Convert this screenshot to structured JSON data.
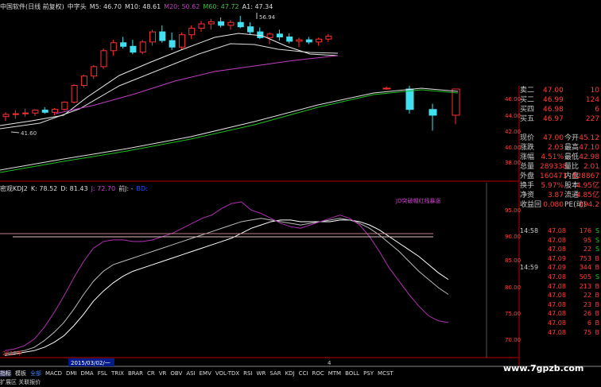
{
  "header": {
    "title": "中国软件(日线 前复权)",
    "pattern": "中字头",
    "ma5": "M5: 46.70",
    "ma10": "M10: 48.61",
    "ma20": "M20: 50.62",
    "ma60": "M60: 47.72",
    "a1": "A1: 47.34"
  },
  "kline": {
    "high_label": "56.94",
    "low_label": "41.60",
    "candles": [
      [
        43.0,
        43.6,
        42.4,
        43.3
      ],
      [
        43.3,
        43.9,
        42.7,
        43.4
      ],
      [
        43.4,
        44.1,
        43.0,
        43.5
      ],
      [
        43.5,
        44.0,
        43.1,
        43.9
      ],
      [
        43.9,
        44.3,
        43.4,
        43.6
      ],
      [
        43.6,
        44.2,
        43.2,
        44.0
      ],
      [
        44.0,
        45.1,
        43.8,
        45.0
      ],
      [
        45.0,
        47.5,
        44.8,
        47.3
      ],
      [
        47.3,
        48.8,
        47.0,
        48.6
      ],
      [
        48.6,
        50.1,
        48.2,
        49.9
      ],
      [
        49.9,
        52.4,
        49.6,
        52.1
      ],
      [
        52.1,
        53.6,
        51.4,
        53.2
      ],
      [
        53.2,
        54.0,
        52.4,
        52.7
      ],
      [
        52.7,
        53.6,
        51.6,
        51.9
      ],
      [
        51.9,
        53.6,
        51.6,
        53.3
      ],
      [
        53.3,
        55.0,
        52.8,
        54.7
      ],
      [
        54.7,
        55.6,
        53.2,
        53.5
      ],
      [
        53.5,
        54.6,
        52.2,
        52.6
      ],
      [
        52.6,
        54.6,
        52.2,
        54.3
      ],
      [
        54.3,
        55.6,
        53.7,
        55.2
      ],
      [
        55.2,
        56.2,
        54.7,
        55.8
      ],
      [
        55.8,
        56.5,
        55.0,
        56.1
      ],
      [
        56.1,
        56.7,
        55.3,
        55.6
      ],
      [
        55.6,
        56.3,
        55.0,
        56.0
      ],
      [
        56.0,
        56.9,
        55.2,
        55.4
      ],
      [
        55.4,
        56.0,
        54.4,
        54.7
      ],
      [
        54.7,
        55.3,
        53.7,
        53.9
      ],
      [
        53.9,
        54.6,
        53.0,
        54.4
      ],
      [
        54.4,
        55.0,
        53.5,
        54.0
      ],
      [
        54.0,
        54.5,
        53.1,
        53.4
      ],
      [
        53.4,
        53.9,
        52.6,
        53.6
      ],
      [
        53.6,
        54.0,
        53.0,
        53.3
      ],
      [
        53.3,
        53.9,
        52.8,
        53.7
      ],
      [
        53.7,
        54.4,
        53.3,
        54.1
      ]
    ],
    "right_candles": [
      [
        47.1,
        47.3,
        46.9,
        47.1
      ],
      [
        47.0,
        47.4,
        44.0,
        44.5
      ],
      [
        44.5,
        45.2,
        41.9,
        43.8
      ],
      [
        43.8,
        47.0,
        42.7,
        47.0
      ]
    ]
  },
  "kdj": {
    "title": "密观KDJ2",
    "k": "K: 78.52",
    "d": "D: 81.43",
    "j": "J: 72.70",
    "extra": "前J: -",
    "extra2": "BD:",
    "annotation": "JD突破帽红线暴涨",
    "k_series": [
      8,
      9,
      10,
      12,
      16,
      21,
      27,
      35,
      44,
      52,
      58,
      62,
      64,
      66,
      68,
      70,
      72,
      74,
      76,
      78,
      80,
      82,
      84,
      86,
      88,
      89,
      90,
      89,
      88,
      87,
      86,
      87,
      88,
      89,
      90,
      89,
      87,
      84,
      80,
      75,
      70,
      64,
      58,
      53,
      48,
      44
    ],
    "d_series": [
      7,
      8,
      9,
      10,
      12,
      15,
      19,
      25,
      32,
      40,
      46,
      51,
      55,
      58,
      60,
      62,
      64,
      66,
      68,
      70,
      72,
      74,
      76,
      78,
      81,
      84,
      86,
      88,
      89,
      89,
      88,
      88,
      88,
      88,
      89,
      89,
      88,
      86,
      83,
      79,
      75,
      71,
      67,
      62,
      57,
      53
    ],
    "j_series": [
      10,
      11,
      13,
      17,
      24,
      33,
      43,
      54,
      64,
      72,
      76,
      77,
      77,
      76,
      76,
      77,
      79,
      81,
      84,
      87,
      90,
      92,
      96,
      99,
      100,
      95,
      93,
      90,
      87,
      85,
      84,
      86,
      88,
      90,
      92,
      90,
      86,
      79,
      70,
      60,
      52,
      44,
      37,
      31,
      28,
      27
    ]
  },
  "axis": {
    "price_ticks": [
      "46.00",
      "44.00",
      "42.00",
      "40.00",
      "38.00"
    ],
    "kdj_ticks": [
      "95.00",
      "90.00",
      "85.00",
      "80.00",
      "75.00",
      "70.00"
    ],
    "date_label": "2015年",
    "date_range": "2015/03/02/一",
    "cursor_num": "4"
  },
  "quote": {
    "asks": [
      {
        "label": "卖二",
        "price": "47.00",
        "vol": "10"
      },
      {
        "label": "买二",
        "price": "46.99",
        "vol": "124"
      },
      {
        "label": "买四",
        "price": "46.98",
        "vol": "6"
      },
      {
        "label": "买五",
        "price": "46.97",
        "vol": "227"
      }
    ],
    "stats": [
      {
        "k1": "现价",
        "v1": "47.00",
        "k2": "今开",
        "v2": "45.12"
      },
      {
        "k1": "涨跌",
        "v1": "2.03",
        "k2": "最高",
        "v2": "47.10"
      },
      {
        "k1": "涨幅",
        "v1": "4.51%",
        "k2": "最低",
        "v2": "42.98"
      },
      {
        "k1": "总量",
        "v1": "289338",
        "k2": "量比",
        "v2": "2.01"
      },
      {
        "k1": "外盘",
        "v1": "160471",
        "k2": "内盘",
        "v2": "128867"
      },
      {
        "k1": "换手",
        "v1": "5.97%",
        "k2": "股本",
        "v2": "4.95亿"
      },
      {
        "k1": "净资",
        "v1": "3.87",
        "k2": "流通",
        "v2": "4.85亿"
      },
      {
        "k1": "收益回",
        "v1": "0.080",
        "k2": "PE(动)",
        "v2": "694.2"
      }
    ],
    "ticks": [
      {
        "time": "14:58",
        "price": "47.08",
        "vol": "176",
        "flag": "S"
      },
      {
        "time": "",
        "price": "47.08",
        "vol": "95",
        "flag": "S"
      },
      {
        "time": "",
        "price": "47.08",
        "vol": "22",
        "flag": "S"
      },
      {
        "time": "",
        "price": "47.09",
        "vol": "753",
        "flag": "B"
      },
      {
        "time": "14:59",
        "price": "47.09",
        "vol": "344",
        "flag": "B"
      },
      {
        "time": "",
        "price": "47.08",
        "vol": "505",
        "flag": "S"
      },
      {
        "time": "",
        "price": "47.08",
        "vol": "213",
        "flag": "B"
      },
      {
        "time": "",
        "price": "47.08",
        "vol": "22",
        "flag": "B"
      },
      {
        "time": "",
        "price": "47.08",
        "vol": "23",
        "flag": "B"
      },
      {
        "time": "",
        "price": "47.08",
        "vol": "26",
        "flag": "B"
      },
      {
        "time": "",
        "price": "47.08",
        "vol": "6",
        "flag": "B"
      },
      {
        "time": "",
        "price": "47.08",
        "vol": "75",
        "flag": "B"
      }
    ]
  },
  "tabs": {
    "left1": "指标",
    "left2": "模板",
    "items": [
      "全部",
      "MACD",
      "DMI",
      "DMA",
      "FSL",
      "TRIX",
      "BRAR",
      "CR",
      "VR",
      "OBV",
      "ASI",
      "EMV",
      "VOL-TDX",
      "RSI",
      "WR",
      "SAR",
      "KDJ",
      "CCI",
      "ROC",
      "MTM",
      "BOLL",
      "PSY",
      "MCST"
    ],
    "bottom": "扩展区 关联报价"
  },
  "watermark": "www.7gpzb.com"
}
